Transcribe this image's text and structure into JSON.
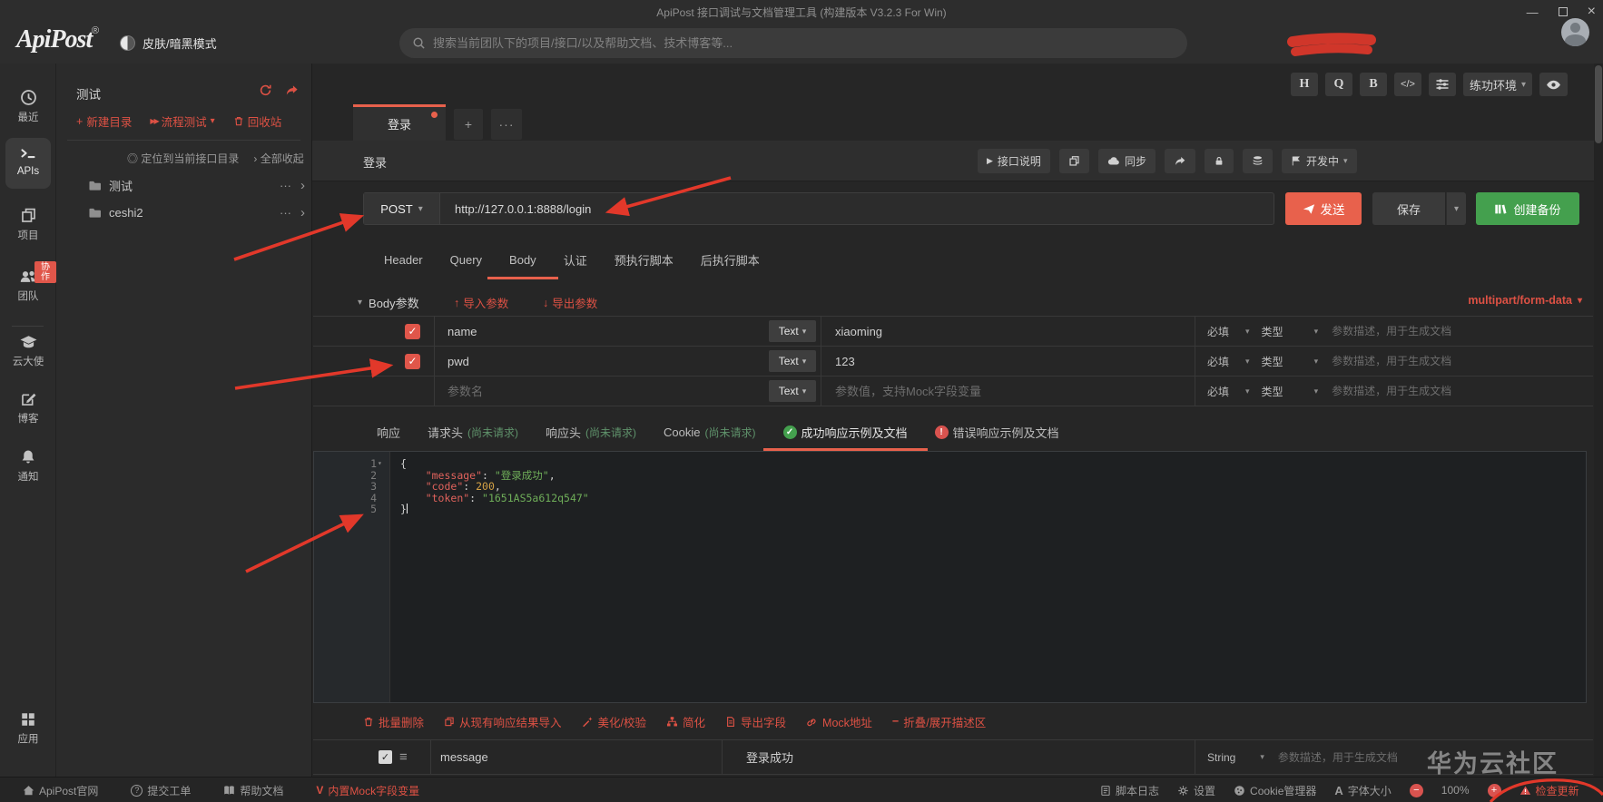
{
  "colors": {
    "accent_red": "#e8614c",
    "link_red": "#dd5144",
    "green": "#44a04e",
    "hint_green": "#5f926b",
    "editor_key": "#e0625c",
    "editor_string": "#6fae59",
    "editor_number": "#d4a145"
  },
  "titlebar": {
    "title": "ApiPost 接口调试与文档管理工具 (构建版本 V3.2.3 For Win)"
  },
  "header": {
    "logo": "ApiPost",
    "registered": "®",
    "theme_toggle_label": "皮肤/暗黑模式",
    "search_placeholder": "搜索当前团队下的项目/接口/以及帮助文档、技术博客等..."
  },
  "rail": {
    "items": [
      {
        "label": "最近"
      },
      {
        "label": "APIs"
      },
      {
        "label": "项目"
      },
      {
        "label": "团队",
        "badge": "协作"
      },
      {
        "label": "云大使"
      },
      {
        "label": "博客"
      },
      {
        "label": "通知"
      }
    ],
    "bottom": {
      "label": "应用"
    }
  },
  "tree": {
    "project": "测试",
    "new_dir": "新建目录",
    "flow_test": "流程测试",
    "recycle": "回收站",
    "locate": "定位到当前接口目录",
    "collapse_all": "全部收起",
    "folders": [
      {
        "name": "测试"
      },
      {
        "name": "ceshi2"
      }
    ]
  },
  "quickbar": {
    "h": "H",
    "q": "Q",
    "b": "B",
    "code": "</>",
    "env": "练功环境"
  },
  "tabs": {
    "active": "登录"
  },
  "doc_row": {
    "title": "登录",
    "api_desc": "接口说明",
    "sync": "同步",
    "status": "开发中"
  },
  "request": {
    "method": "POST",
    "url": "http://127.0.0.1:8888/login",
    "send": "发送",
    "save": "保存",
    "backup": "创建备份"
  },
  "request_tabs": [
    "Header",
    "Query",
    "Body",
    "认证",
    "预执行脚本",
    "后执行脚本"
  ],
  "body_section": {
    "title": "Body参数",
    "import_label": "导入参数",
    "export_label": "导出参数",
    "content_type": "multipart/form-data"
  },
  "params": {
    "rows": [
      {
        "key": "name",
        "type": "Text",
        "value": "xiaoming"
      },
      {
        "key": "pwd",
        "type": "Text",
        "value": "123"
      },
      {
        "type": "Text",
        "key_placeholder": "参数名",
        "value_placeholder": "参数值，支持Mock字段变量"
      }
    ],
    "required_label": "必填",
    "type_label": "类型",
    "desc_placeholder": "参数描述，用于生成文档"
  },
  "response_tabs": {
    "t0": "响应",
    "t1": "请求头",
    "t1_hint": "(尚未请求)",
    "t2": "响应头",
    "t2_hint": "(尚未请求)",
    "t3": "Cookie",
    "t3_hint": "(尚未请求)",
    "t4": "成功响应示例及文档",
    "t5": "错误响应示例及文档"
  },
  "editor": {
    "line_numbers": [
      "1",
      "2",
      "3",
      "4",
      "5"
    ],
    "l1_open": "{",
    "l2_indent": "    ",
    "l2_key": "\"message\"",
    "l2_sep": ": ",
    "l2_val": "\"登录成功\"",
    "l2_comma": ",",
    "l3_indent": "    ",
    "l3_key": "\"code\"",
    "l3_sep": ": ",
    "l3_num": "200",
    "l3_comma": ",",
    "l4_indent": "    ",
    "l4_key": "\"token\"",
    "l4_sep": ": ",
    "l4_val": "\"1651AS5a612q547\"",
    "l5_close": "}"
  },
  "editor_toolbar": [
    "批量删除",
    "从现有响应结果导入",
    "美化/校验",
    "简化",
    "导出字段",
    "Mock地址",
    "折叠/展开描述区"
  ],
  "field_row": {
    "name": "message",
    "value": "登录成功",
    "type": "String",
    "desc_placeholder": "参数描述，用于生成文档"
  },
  "footer": {
    "site": "ApiPost官网",
    "ticket": "提交工单",
    "help": "帮助文档",
    "mock_vars": "内置Mock字段变量",
    "script_log": "脚本日志",
    "settings": "设置",
    "cookie_mgr": "Cookie管理器",
    "font_size": "字体大小",
    "zoom": "100%",
    "check_update": "检查更新"
  },
  "watermark": "华为云社区",
  "icons": {
    "caret_down": "▾",
    "play": "▶",
    "flow": "▶▶",
    "up": "↑",
    "down": "↓",
    "plus": "+",
    "ellipsis": "···",
    "chevron_right": "›",
    "locate": "◎",
    "check": "✓",
    "excl": "!",
    "handle": "≡",
    "minimize": "—",
    "close": "×",
    "refresh": "⟳",
    "question": "?",
    "font_a": "A",
    "minus": "−",
    "v": "V",
    "collapse_minus": "−"
  }
}
